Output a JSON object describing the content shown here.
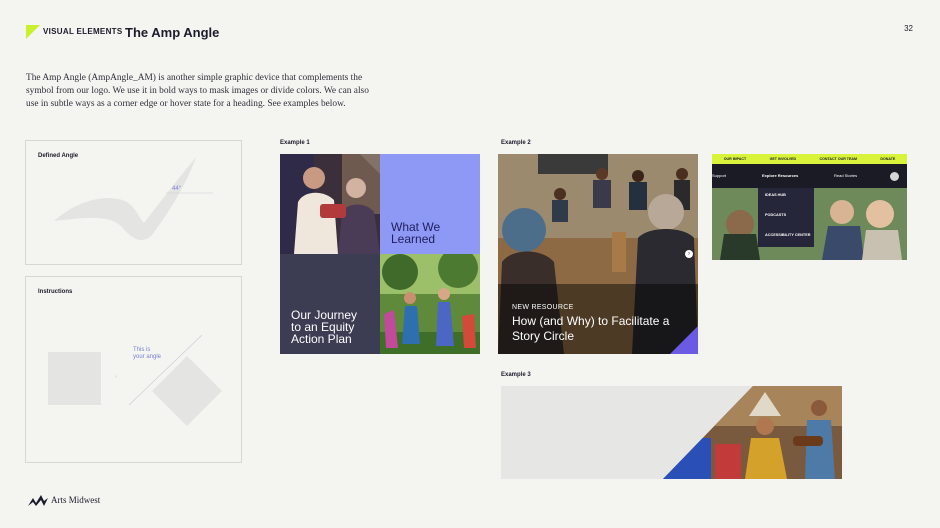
{
  "header": {
    "section_label": "VISUAL ELEMENTS",
    "title": "The Amp Angle",
    "page_number": "32"
  },
  "intro": "The Amp Angle (AmpAngle_AM) is another simple graphic device that complements the symbol from our logo. We use it in bold ways to mask images or divide colors. We can also use in subtle ways as a corner edge or hover state for a heading. See examples below.",
  "defined_angle": {
    "label": "Defined Angle",
    "angle": "44°"
  },
  "instructions": {
    "label": "Instructions",
    "note_line1": "This is",
    "note_line2": "your angle"
  },
  "examples": {
    "example1": {
      "label": "Example 1",
      "tile_purple": "What We\nLearned",
      "tile_navy": "Our Journey\nto an Equity\nAction Plan"
    },
    "example2": {
      "label": "Example 2",
      "kicker": "NEW RESOURCE",
      "title": "How (and Why) to Facilitate a Story Circle"
    },
    "nav_mock": {
      "top_items": [
        "OUR IMPACT",
        "GET INVOLVED",
        "CONTACT OUR TEAM",
        "DONATE"
      ],
      "left_link": "Support",
      "active_link": "Explore Resources",
      "right_link": "Read Stories",
      "menu_items": [
        "IDEAS HUB",
        "PODCASTS",
        "ACCESSIBILITY CENTER"
      ]
    },
    "example3": {
      "label": "Example 3"
    }
  },
  "footer": {
    "logo_text": "Arts Midwest"
  },
  "colors": {
    "accent_green": "#c8f02c",
    "purple": "#8e98f5",
    "navy": "#3c3c53",
    "angle_blue": "#7b7fd8",
    "light_gray": "#e4e4e2"
  }
}
